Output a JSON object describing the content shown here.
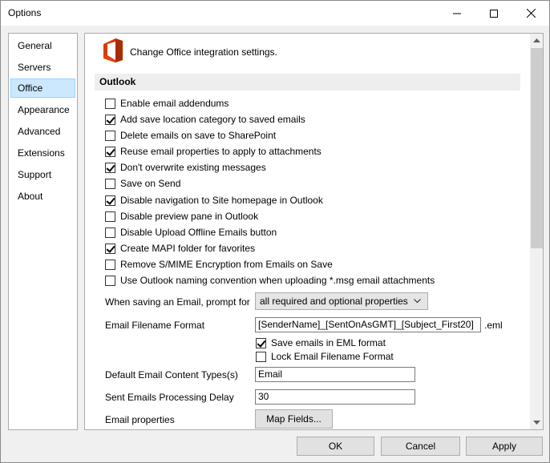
{
  "window": {
    "title": "Options",
    "controls": {
      "minimize_icon": "minimize-icon",
      "maximize_icon": "maximize-icon",
      "close_icon": "close-icon"
    }
  },
  "nav": {
    "items": [
      {
        "label": "General",
        "selected": false
      },
      {
        "label": "Servers",
        "selected": false
      },
      {
        "label": "Office",
        "selected": true
      },
      {
        "label": "Appearance",
        "selected": false
      },
      {
        "label": "Advanced",
        "selected": false
      },
      {
        "label": "Extensions",
        "selected": false
      },
      {
        "label": "Support",
        "selected": false
      },
      {
        "label": "About",
        "selected": false
      }
    ]
  },
  "panel": {
    "header": "Change Office integration settings.",
    "logo_icon": "office-logo-icon",
    "section_title": "Outlook",
    "checkboxes": [
      {
        "label": "Enable email addendums",
        "checked": false
      },
      {
        "label": "Add save location category to saved emails",
        "checked": true
      },
      {
        "label": "Delete emails on save to SharePoint",
        "checked": false
      },
      {
        "label": "Reuse email properties to apply to attachments",
        "checked": true
      },
      {
        "label": "Don't overwrite existing messages",
        "checked": true
      },
      {
        "label": "Save on Send",
        "checked": false
      },
      {
        "label": "Disable navigation to Site homepage in Outlook",
        "checked": true
      },
      {
        "label": "Disable preview pane in Outlook",
        "checked": false
      },
      {
        "label": "Disable Upload Offline Emails button",
        "checked": false
      },
      {
        "label": "Create MAPI folder for favorites",
        "checked": true
      },
      {
        "label": "Remove S/MIME Encryption from Emails on Save",
        "checked": false
      },
      {
        "label": "Use Outlook naming convention when uploading *.msg email attachments",
        "checked": false
      }
    ],
    "prompt": {
      "label": "When saving an Email, prompt for",
      "value": "all required and optional properties"
    },
    "filename": {
      "label": "Email Filename Format",
      "value": "[SenderName]_[SentOnAsGMT]_[Subject_First20]",
      "suffix": ".eml"
    },
    "eml_options": [
      {
        "label": "Save emails in EML format",
        "checked": true
      },
      {
        "label": "Lock Email Filename Format",
        "checked": false
      }
    ],
    "content_types": {
      "label": "Default Email Content Types(s)",
      "value": "Email"
    },
    "delay": {
      "label": "Sent Emails Processing Delay",
      "value": "30"
    },
    "properties": {
      "label": "Email properties",
      "button": "Map Fields..."
    }
  },
  "footer": {
    "ok": "OK",
    "cancel": "Cancel",
    "apply": "Apply"
  },
  "colors": {
    "selection": "#cce8ff",
    "office_red": "#d83b01"
  }
}
